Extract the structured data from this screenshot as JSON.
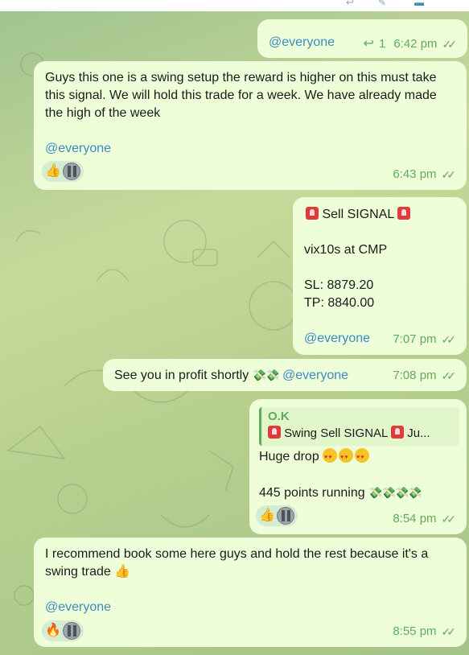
{
  "messages": [
    {
      "id": "m0",
      "mention": "@everyone",
      "reply_count": "1",
      "time": "6:42 pm"
    },
    {
      "id": "m1",
      "text": "Guys this one is a swing setup the reward is higher on this must take this signal. We will hold this trade for a week. We have already made the high of the week",
      "mention": "@everyone",
      "reactions": [
        "thumbs-up",
        "avatar"
      ],
      "time": "6:43 pm"
    },
    {
      "id": "m2",
      "title": "Sell SIGNAL",
      "line1": "vix10s at CMP",
      "sl": "SL: 8879.20",
      "tp": "TP: 8840.00",
      "mention": "@everyone",
      "time": "7:07 pm"
    },
    {
      "id": "m3",
      "text": "See you in profit shortly",
      "mention": "@everyone",
      "time": "7:08 pm"
    },
    {
      "id": "m4",
      "quote_author": "O.K",
      "quote_text": "Swing Sell SIGNAL",
      "quote_more": "Ju...",
      "line1": "Huge drop",
      "line2": "445 points running",
      "reactions": [
        "thumbs-up",
        "avatar"
      ],
      "time": "8:54 pm"
    },
    {
      "id": "m5",
      "text": "I recommend book some here guys and hold the rest because it's a swing trade",
      "mention": "@everyone",
      "reactions": [
        "fire",
        "avatar"
      ],
      "time": "8:55 pm"
    }
  ],
  "icons": {
    "thumbs_up": "👍",
    "fire": "🔥",
    "money": "💸",
    "read": "✓✓",
    "reply": "↩"
  },
  "colors": {
    "outgoing_bubble": "#eefed9",
    "incoming_bubble": "#ffffff",
    "accent_green": "#5faa5b",
    "mention_blue": "#3a8cc1"
  }
}
